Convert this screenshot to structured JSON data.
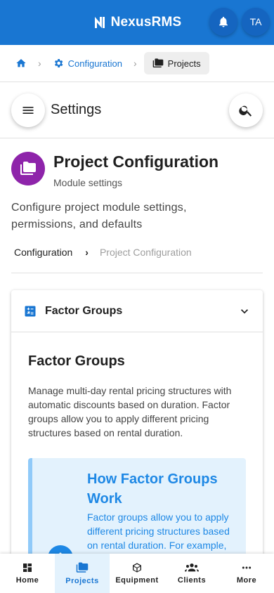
{
  "app": {
    "brand": "NexusRMS",
    "avatar_initials": "TA",
    "accent": "#1976d2",
    "module_color": "#8e24aa"
  },
  "breadcrumb": {
    "home_icon": "home-icon",
    "config_label": "Configuration",
    "current_label": "Projects"
  },
  "settings": {
    "title": "Settings"
  },
  "page": {
    "title": "Project Configuration",
    "subtitle": "Module settings",
    "description": "Configure project module settings, permissions, and defaults",
    "trail": {
      "link": "Configuration",
      "current": "Project Configuration"
    }
  },
  "accordion": {
    "header": "Factor Groups",
    "section_title": "Factor Groups",
    "section_desc": "Manage multi-day rental pricing structures with automatic discounts based on duration. Factor groups allow you to apply different pricing structures based on rental duration.",
    "info_title": "How Factor Groups Work",
    "info_text": "Factor groups allow you to apply different pricing structures based on rental duration. For example, you can offer"
  },
  "nav": {
    "items": [
      {
        "label": "Home",
        "icon": "dashboard-icon"
      },
      {
        "label": "Projects",
        "icon": "folder-icon"
      },
      {
        "label": "Equipment",
        "icon": "box-icon"
      },
      {
        "label": "Clients",
        "icon": "people-icon"
      },
      {
        "label": "More",
        "icon": "more-icon"
      }
    ],
    "active": "Projects"
  }
}
